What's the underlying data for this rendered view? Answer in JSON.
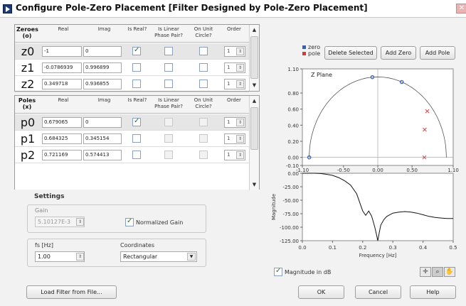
{
  "window": {
    "title": "Configure Pole-Zero Placement [Filter Designed by Pole-Zero Placement]",
    "close_glyph": "✕"
  },
  "zeroes_table": {
    "header_label": "Zeroes\n(o)",
    "columns": [
      "Real",
      "Imag",
      "Is Real?",
      "Is Linear\nPhase Pair?",
      "On Unit\nCircle?",
      "Order"
    ],
    "rows": [
      {
        "label": "z0",
        "real": "-1",
        "imag": "0",
        "is_real": true,
        "linear": false,
        "unit": false,
        "order": "1"
      },
      {
        "label": "z1",
        "real": "-0.0786939",
        "imag": "0.996899",
        "is_real": false,
        "linear": false,
        "unit": false,
        "order": "1"
      },
      {
        "label": "z2",
        "real": "0.349718",
        "imag": "0.936855",
        "is_real": false,
        "linear": false,
        "unit": false,
        "order": "1"
      }
    ]
  },
  "poles_table": {
    "header_label": "Poles\n(x)",
    "columns": [
      "Real",
      "Imag",
      "Is Real?",
      "Is Linear\nPhase Pair?",
      "On Unit\nCircle?",
      "Order"
    ],
    "rows": [
      {
        "label": "p0",
        "real": "0.679065",
        "imag": "0",
        "is_real": true,
        "order": "1"
      },
      {
        "label": "p1",
        "real": "0.684325",
        "imag": "0.345154",
        "is_real": false,
        "order": "1"
      },
      {
        "label": "p2",
        "real": "0.721169",
        "imag": "0.574413",
        "is_real": false,
        "order": "1"
      }
    ]
  },
  "settings": {
    "title": "Settings",
    "gain_label": "Gain",
    "gain_value": "5.10127E-3",
    "normalized_gain_label": "Normalized Gain",
    "normalized_gain_checked": true,
    "fs_label": "fs [Hz]",
    "fs_value": "1.00",
    "coordinates_label": "Coordinates",
    "coordinates_value": "Rectangular"
  },
  "zplane": {
    "legend_zero": "zero",
    "legend_pole": "pole",
    "zero_color": "#3a5fb0",
    "pole_color": "#d83a3a",
    "delete_button": "Delete Selected",
    "add_zero_button": "Add Zero",
    "add_pole_button": "Add Pole",
    "plot_label": "Z Plane"
  },
  "magnitude_plot": {
    "ylabel": "Magnitude",
    "xlabel": "Frequency [Hz]",
    "in_db_label": "Magnitude in dB",
    "in_db_checked": true
  },
  "buttons": {
    "load": "Load Filter from File...",
    "ok": "OK",
    "cancel": "Cancel",
    "help": "Help"
  },
  "chart_data": [
    {
      "type": "scatter",
      "title": "Z Plane",
      "xlim": [
        -1.1,
        1.1
      ],
      "ylim": [
        -0.1,
        1.1
      ],
      "x_ticks": [
        "-1.10",
        "-0.50",
        "0.00",
        "0.50",
        "1.10"
      ],
      "y_ticks": [
        "1.10",
        "0.80",
        "0.60",
        "0.40",
        "0.20",
        "0.00",
        "-0.10"
      ],
      "unit_circle": true,
      "series": [
        {
          "name": "zero",
          "points": [
            [
              -1,
              0
            ],
            [
              -0.0786939,
              0.996899
            ],
            [
              0.349718,
              0.936855
            ]
          ]
        },
        {
          "name": "pole",
          "points": [
            [
              0.679065,
              0
            ],
            [
              0.684325,
              0.345154
            ],
            [
              0.721169,
              0.574413
            ]
          ]
        }
      ]
    },
    {
      "type": "line",
      "xlabel": "Frequency [Hz]",
      "ylabel": "Magnitude",
      "xlim": [
        0,
        0.5
      ],
      "ylim": [
        -125,
        0
      ],
      "x_ticks": [
        "0.0",
        "0.1",
        "0.2",
        "0.3",
        "0.4",
        "0.5"
      ],
      "y_ticks": [
        "0.00",
        "-25.00",
        "-50.00",
        "-75.00",
        "-100.00",
        "-125.00"
      ],
      "x": [
        0,
        0.02,
        0.04,
        0.06,
        0.08,
        0.1,
        0.12,
        0.14,
        0.16,
        0.18,
        0.2,
        0.21,
        0.22,
        0.23,
        0.24,
        0.245,
        0.25,
        0.255,
        0.26,
        0.27,
        0.28,
        0.3,
        0.32,
        0.34,
        0.36,
        0.38,
        0.4,
        0.42,
        0.44,
        0.46,
        0.48,
        0.5
      ],
      "values": [
        0,
        0,
        0,
        -0.5,
        -2,
        -4,
        -8,
        -14,
        -22,
        -38,
        -70,
        -78,
        -70,
        -80,
        -100,
        -112,
        -125,
        -110,
        -96,
        -86,
        -80,
        -74,
        -72,
        -71,
        -72,
        -74,
        -77,
        -80,
        -82,
        -83,
        -84,
        -84
      ]
    }
  ]
}
